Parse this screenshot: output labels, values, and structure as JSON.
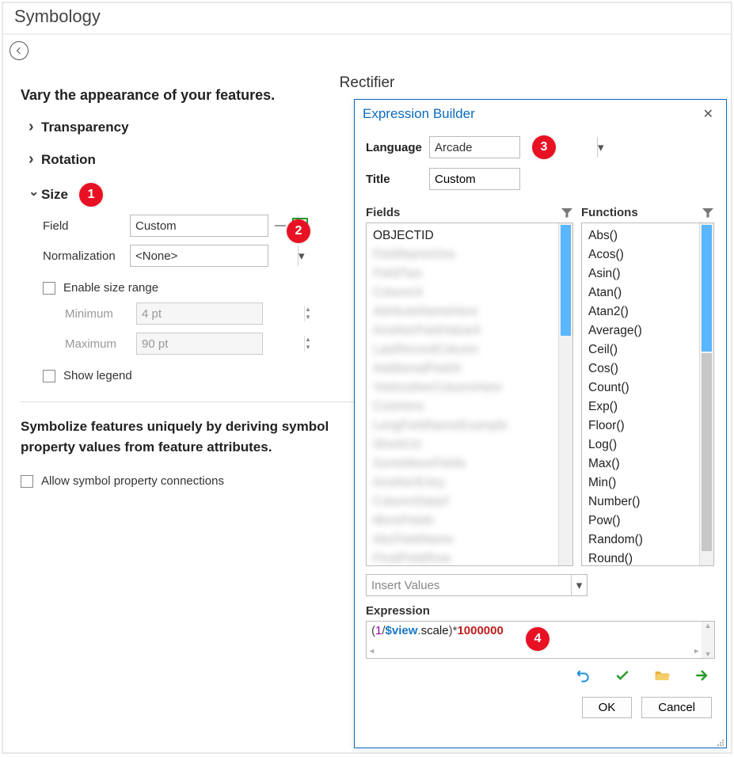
{
  "panel": {
    "title": "Symbology",
    "layer_name": "Rectifier",
    "heading": "Vary the appearance of your features.",
    "sections": {
      "transparency": "Transparency",
      "rotation": "Rotation",
      "size": "Size"
    },
    "size": {
      "field_label": "Field",
      "field_value": "Custom",
      "norm_label": "Normalization",
      "norm_value": "<None>",
      "enable_range": "Enable size range",
      "min_label": "Minimum",
      "min_value": "4 pt",
      "max_label": "Maximum",
      "max_value": "90 pt",
      "show_legend": "Show legend"
    },
    "unique_heading": "Symbolize features uniquely by deriving symbol property values from feature attributes.",
    "allow_conn": "Allow symbol property connections"
  },
  "callouts": {
    "c1": "1",
    "c2": "2",
    "c3": "3",
    "c4": "4"
  },
  "dialog": {
    "title": "Expression Builder",
    "lang_label": "Language",
    "lang_value": "Arcade",
    "title_label": "Title",
    "title_value": "Custom",
    "fields_label": "Fields",
    "funcs_label": "Functions",
    "fields": [
      "OBJECTID"
    ],
    "functions": [
      "Abs()",
      "Acos()",
      "Asin()",
      "Atan()",
      "Atan2()",
      "Average()",
      "Ceil()",
      "Cos()",
      "Count()",
      "Exp()",
      "Floor()",
      "Log()",
      "Max()",
      "Min()",
      "Number()",
      "Pow()",
      "Random()",
      "Round()"
    ],
    "insert_values": "Insert Values",
    "expr_label": "Expression",
    "expression": {
      "raw": "(1/$view.scale)*1000000",
      "parts": {
        "open": "(",
        "one": "1",
        "slash": "/",
        "var": "$view",
        "dot": ".",
        "prop": "scale",
        "close": ")",
        "mul": "*",
        "mill": "1000000"
      }
    },
    "ok": "OK",
    "cancel": "Cancel"
  }
}
